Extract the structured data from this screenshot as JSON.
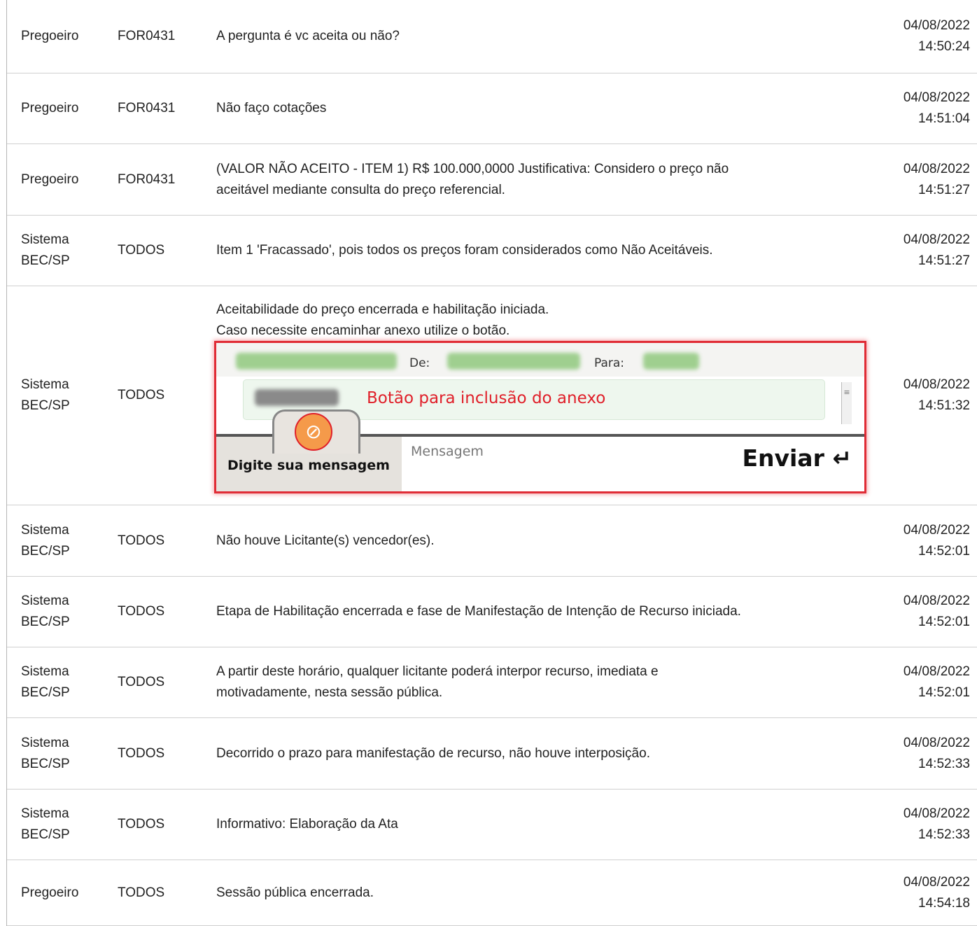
{
  "messages": [
    {
      "from": [
        "Pregoeiro"
      ],
      "to": "FOR0431",
      "text": [
        "A pergunta é vc aceita ou não?"
      ],
      "date": "04/08/2022",
      "time": "14:50:24"
    },
    {
      "from": [
        "Pregoeiro"
      ],
      "to": "FOR0431",
      "text": [
        "Não faço cotações"
      ],
      "date": "04/08/2022",
      "time": "14:51:04"
    },
    {
      "from": [
        "Pregoeiro"
      ],
      "to": "FOR0431",
      "text": [
        "(VALOR NÃO ACEITO - ITEM 1) R$ 100.000,0000 Justificativa: Considero o preço não",
        "aceitável mediante consulta do preço referencial."
      ],
      "date": "04/08/2022",
      "time": "14:51:27"
    },
    {
      "from": [
        "Sistema",
        "BEC/SP"
      ],
      "to": "TODOS",
      "text": [
        "Item 1 'Fracassado', pois todos os preços foram considerados como Não Aceitáveis."
      ],
      "date": "04/08/2022",
      "time": "14:51:27"
    },
    {
      "from": [
        "Sistema",
        "BEC/SP"
      ],
      "to": "TODOS",
      "text": [
        "Aceitabilidade do preço encerrada e habilitação iniciada.",
        "Caso necessite encaminhar anexo utilize o botão."
      ],
      "date": "04/08/2022",
      "time": "14:51:32"
    },
    {
      "from": [
        "Sistema",
        "BEC/SP"
      ],
      "to": "TODOS",
      "text": [
        "Não houve Licitante(s) vencedor(es)."
      ],
      "date": "04/08/2022",
      "time": "14:52:01"
    },
    {
      "from": [
        "Sistema",
        "BEC/SP"
      ],
      "to": "TODOS",
      "text": [
        "Etapa de Habilitação encerrada e fase de Manifestação de Intenção de Recurso iniciada."
      ],
      "date": "04/08/2022",
      "time": "14:52:01"
    },
    {
      "from": [
        "Sistema",
        "BEC/SP"
      ],
      "to": "TODOS",
      "text": [
        "A partir deste horário, qualquer licitante poderá interpor recurso, imediata e",
        "motivadamente, nesta sessão pública."
      ],
      "date": "04/08/2022",
      "time": "14:52:01"
    },
    {
      "from": [
        "Sistema",
        "BEC/SP"
      ],
      "to": "TODOS",
      "text": [
        "Decorrido o prazo para manifestação de recurso, não houve interposição."
      ],
      "date": "04/08/2022",
      "time": "14:52:33"
    },
    {
      "from": [
        "Sistema",
        "BEC/SP"
      ],
      "to": "TODOS",
      "text": [
        "Informativo: Elaboração da Ata"
      ],
      "date": "04/08/2022",
      "time": "14:52:33"
    },
    {
      "from": [
        "Pregoeiro"
      ],
      "to": "TODOS",
      "text": [
        "Sessão pública encerrada."
      ],
      "date": "04/08/2022",
      "time": "14:54:18"
    }
  ],
  "help_image": {
    "from_label": "De:",
    "to_label": "Para:",
    "annotation": "Botão para inclusão do anexo",
    "type_prompt": "Digite sua mensagem",
    "placeholder": "Mensagem",
    "send_label": "Enviar ↵",
    "attach_icon": "paperclip-icon",
    "accent_color": "#e0202a"
  }
}
